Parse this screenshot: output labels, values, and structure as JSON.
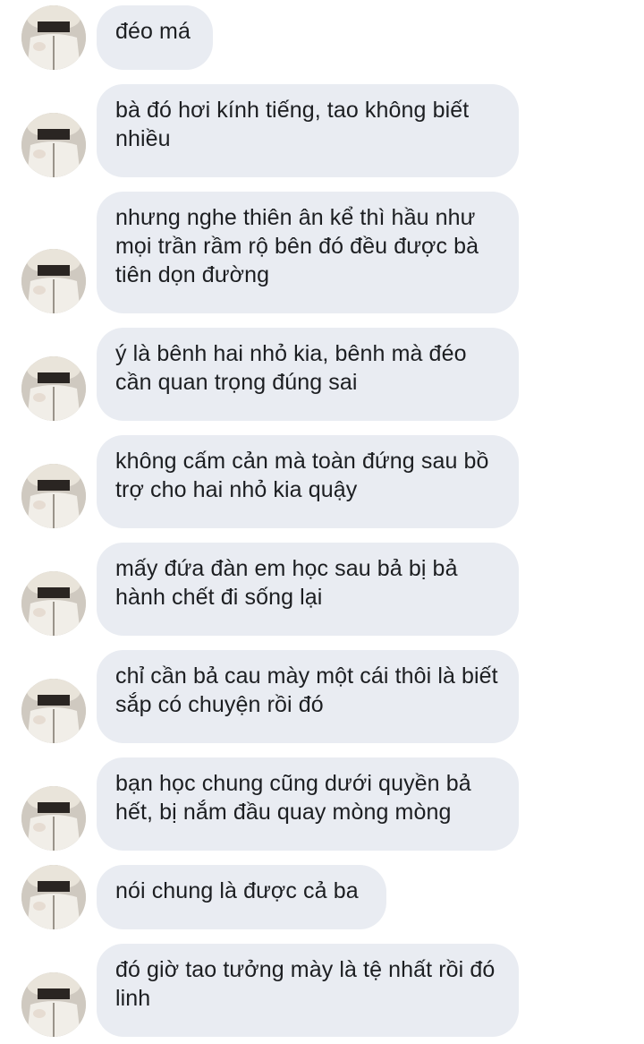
{
  "messages": [
    {
      "text": "đéo má",
      "avatar_icon": "profile-photo-icon"
    },
    {
      "text": "bà đó hơi kính tiếng, tao không biết nhiều",
      "avatar_icon": "profile-photo-icon"
    },
    {
      "text": "nhưng nghe thiên ân kể thì hầu như mọi trần rầm rộ bên đó đều được bà tiên dọn đường",
      "avatar_icon": "profile-photo-icon"
    },
    {
      "text": "ý là bênh hai nhỏ kia, bênh mà đéo cần quan trọng đúng sai",
      "avatar_icon": "profile-photo-icon"
    },
    {
      "text": "không cấm cản mà toàn đứng sau bồ trợ cho hai nhỏ kia quậy",
      "avatar_icon": "profile-photo-icon"
    },
    {
      "text": "mấy đứa đàn em học sau bả bị bả hành chết đi sống lại",
      "avatar_icon": "profile-photo-icon"
    },
    {
      "text": "chỉ cần bả cau mày một cái thôi là biết sắp có chuyện rồi đó",
      "avatar_icon": "profile-photo-icon"
    },
    {
      "text": "bạn học chung cũng dưới quyền bả hết, bị nắm đầu quay mòng mòng",
      "avatar_icon": "profile-photo-icon"
    },
    {
      "text": "nói chung là được cả ba",
      "avatar_icon": "profile-photo-icon"
    },
    {
      "text": "đó giờ tao tưởng mày là tệ nhất rồi đó linh",
      "avatar_icon": "profile-photo-icon"
    }
  ]
}
